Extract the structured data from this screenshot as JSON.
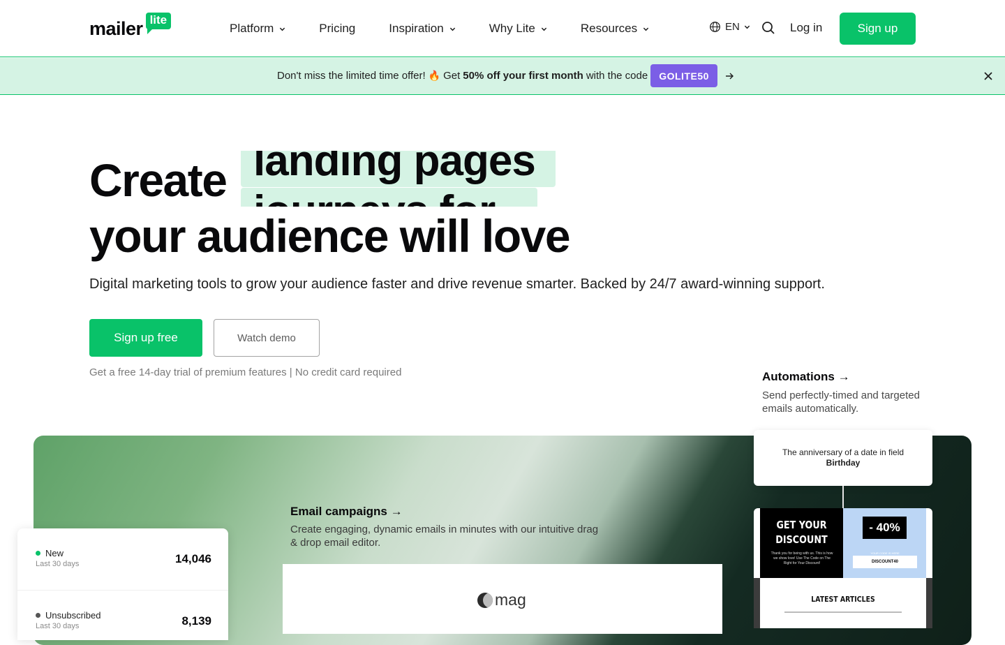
{
  "brand": {
    "word": "mailer",
    "badge": "lite",
    "accent": "#09c269",
    "promo_code_color": "#7b5ee6"
  },
  "nav": {
    "items": [
      {
        "label": "Platform",
        "has_dropdown": true
      },
      {
        "label": "Pricing",
        "has_dropdown": false
      },
      {
        "label": "Inspiration",
        "has_dropdown": true
      },
      {
        "label": "Why Lite",
        "has_dropdown": true
      },
      {
        "label": "Resources",
        "has_dropdown": true
      }
    ],
    "language": "EN",
    "login": "Log in",
    "signup": "Sign up"
  },
  "promo": {
    "lead": "Don't miss the limited time offer!",
    "icon": "🔥",
    "get": "Get",
    "bold": "50% off your first month",
    "tail": "with the code",
    "code": "GOLITE50"
  },
  "hero": {
    "title_start": "Create",
    "rotating_word_1": "landing pages",
    "rotating_word_2": "journeys for",
    "title_end": "your audience will love",
    "subtitle": "Digital marketing tools to grow your audience faster and drive revenue smarter. Backed by 24/7 award-winning support.",
    "cta_primary": "Sign up free",
    "cta_secondary": "Watch demo",
    "note": "Get a free 14-day trial of premium features | No credit card required"
  },
  "features": {
    "automations": {
      "title": "Automations →",
      "desc": "Send perfectly-timed and targeted emails automatically.",
      "card_text": "The anniversary of a date in field",
      "card_bold": "Birthday"
    },
    "email_campaigns": {
      "title": "Email campaigns →",
      "desc": "Create engaging, dynamic emails in minutes with our intuitive drag & drop email editor.",
      "preview_logo": "mag"
    },
    "email_preview": {
      "headline": "GET YOUR DISCOUNT",
      "small_text": "Thank you for being with us. This is how we show love! Use The Code on The Right for Your Discount!",
      "percent": "- 40%",
      "code_caption": "YOUR CODE IS HERE",
      "code": "DISCOUNT40",
      "section": "LATEST ARTICLES"
    },
    "stats": [
      {
        "label": "New",
        "period": "Last 30 days",
        "value": "14,046",
        "color": "#09c269"
      },
      {
        "label": "Unsubscribed",
        "period": "Last 30 days",
        "value": "8,139",
        "color": "#555555"
      }
    ]
  }
}
